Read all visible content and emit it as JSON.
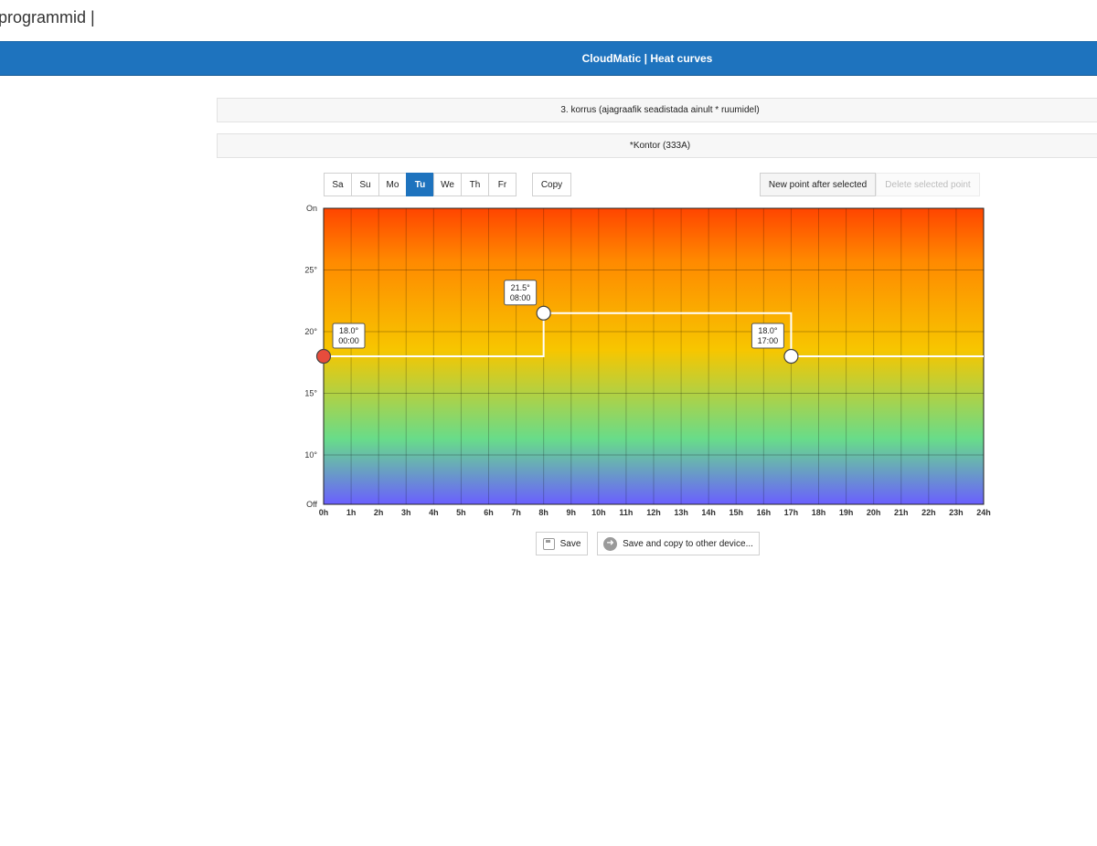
{
  "page": {
    "top_title": "programmid |"
  },
  "header": {
    "title": "CloudMatic | Heat curves"
  },
  "floor": {
    "label": "3. korrus (ajagraafik seadistada ainult * ruumidel)"
  },
  "room": {
    "label": "*Kontor (333A)"
  },
  "days": [
    {
      "label": "Sa",
      "active": false
    },
    {
      "label": "Su",
      "active": false
    },
    {
      "label": "Mo",
      "active": false
    },
    {
      "label": "Tu",
      "active": true
    },
    {
      "label": "We",
      "active": false
    },
    {
      "label": "Th",
      "active": false
    },
    {
      "label": "Fr",
      "active": false
    }
  ],
  "toolbar": {
    "copy_label": "Copy",
    "new_point_label": "New point after selected",
    "delete_point_label": "Delete selected point"
  },
  "footer": {
    "save_label": "Save",
    "save_copy_label": "Save and copy to other device...",
    "save_icon": "floppy-disk-icon",
    "save_copy_icon": "arrow-right-circle-icon"
  },
  "chart_data": {
    "type": "line",
    "step": true,
    "x_ticks": [
      "0h",
      "1h",
      "2h",
      "3h",
      "4h",
      "5h",
      "6h",
      "7h",
      "8h",
      "9h",
      "10h",
      "11h",
      "12h",
      "13h",
      "14h",
      "15h",
      "16h",
      "17h",
      "18h",
      "19h",
      "20h",
      "21h",
      "22h",
      "23h",
      "24h"
    ],
    "y_ticks": [
      {
        "value": 6,
        "label": "Off"
      },
      {
        "value": 10,
        "label": "10°"
      },
      {
        "value": 15,
        "label": "15°"
      },
      {
        "value": 20,
        "label": "20°"
      },
      {
        "value": 25,
        "label": "25°"
      },
      {
        "value": 30,
        "label": "On"
      }
    ],
    "xlim": [
      0,
      24
    ],
    "ylim": [
      6,
      30
    ],
    "grid": true,
    "points": [
      {
        "hour": 0,
        "temp": 18.0,
        "temp_label": "18.0°",
        "time_label": "00:00",
        "selected": true
      },
      {
        "hour": 8,
        "temp": 21.5,
        "temp_label": "21.5°",
        "time_label": "08:00",
        "selected": false
      },
      {
        "hour": 17,
        "temp": 18.0,
        "temp_label": "18.0°",
        "time_label": "17:00",
        "selected": false
      }
    ],
    "colors": {
      "selected_point": "#e74c3c",
      "point": "#ffffff",
      "line": "#ffffff",
      "hot": "#ff4500",
      "mid": "#f7c600",
      "cool": "#68dc8a",
      "cold": "#6a5fff"
    }
  }
}
